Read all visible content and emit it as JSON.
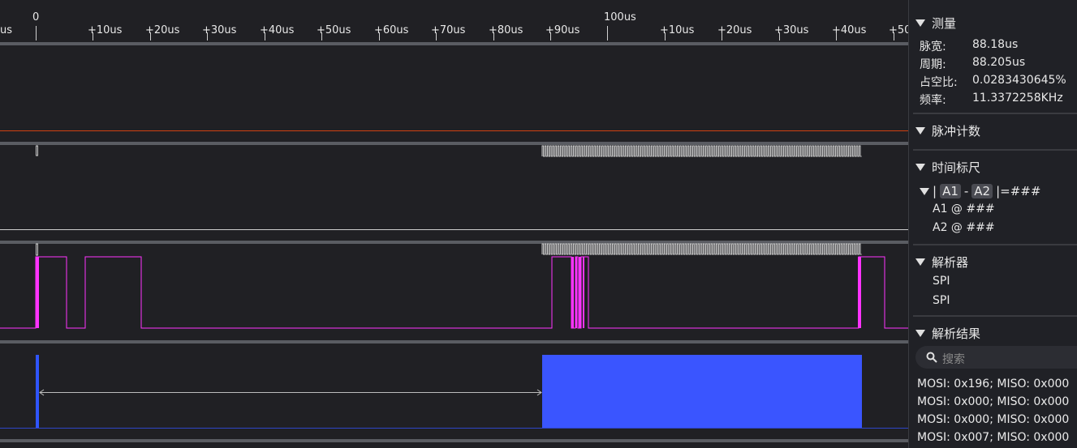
{
  "ruler": {
    "labels": [
      "us",
      "0",
      "+10us",
      "+20us",
      "+30us",
      "+40us",
      "+50us",
      "+60us",
      "+70us",
      "+80us",
      "+90us",
      "100us",
      "+10us",
      "+20us",
      "+30us",
      "+40us",
      "+50"
    ]
  },
  "panel": {
    "measure": {
      "title": "测量",
      "rows": [
        {
          "label": "脉宽:",
          "value": "88.18us"
        },
        {
          "label": "周期:",
          "value": "88.205us"
        },
        {
          "label": "占空比:",
          "value": "0.0283430645%"
        },
        {
          "label": "频率:",
          "value": "11.3372258KHz"
        }
      ]
    },
    "pulse_count": {
      "title": "脉冲计数"
    },
    "time_ruler": {
      "title": "时间标尺",
      "formula": {
        "open": "|",
        "a1": "A1",
        "dash": "-",
        "a2": "A2",
        "close": "|=###"
      },
      "a1_line": "A1 @ ###",
      "a2_line": "A2 @ ###"
    },
    "decoders": {
      "title": "解析器",
      "items": [
        "SPI",
        "SPI"
      ]
    },
    "results": {
      "title": "解析结果",
      "search_placeholder": "搜索",
      "rows": [
        "MOSI: 0x196;  MISO: 0x000",
        "MOSI: 0x000;  MISO: 0x000",
        "MOSI: 0x000;  MISO: 0x000",
        "MOSI: 0x007;  MISO: 0x000"
      ]
    }
  },
  "colors": {
    "background": "#202024",
    "signal": "#ff33ff",
    "marker": "#2f55ff",
    "trace_line": "#d04010",
    "panel": "#202126"
  }
}
